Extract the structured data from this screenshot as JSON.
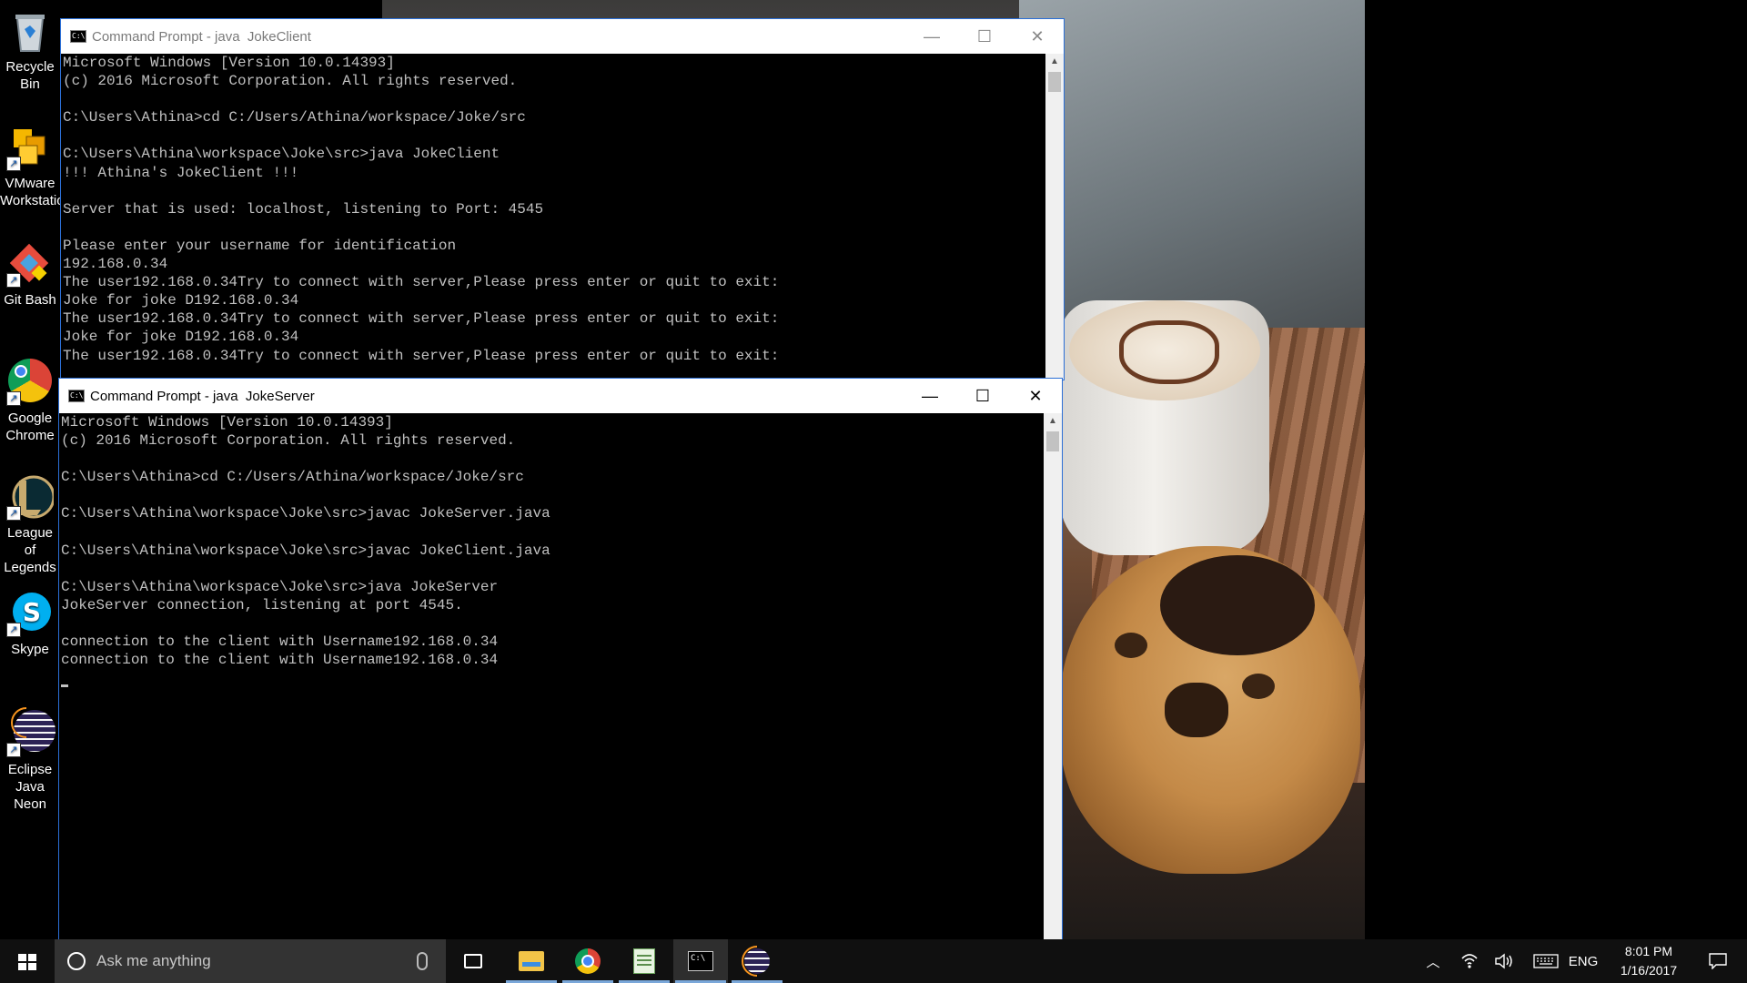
{
  "desktop": {
    "icons": [
      {
        "label": "Recycle Bin",
        "icon": "recycle-bin-icon"
      },
      {
        "label": "VMware Workstation",
        "icon": "vmware-icon"
      },
      {
        "label": "Git Bash",
        "icon": "git-bash-icon"
      },
      {
        "label": "Google Chrome",
        "icon": "chrome-icon"
      },
      {
        "label": "League of Legends",
        "icon": "league-icon"
      },
      {
        "label": "Skype",
        "icon": "skype-icon"
      },
      {
        "label": "Eclipse Java Neon",
        "icon": "eclipse-icon"
      }
    ]
  },
  "client_window": {
    "title": "Command Prompt - java  JokeClient",
    "minimize": "—",
    "maximize": "☐",
    "close": "✕",
    "lines": [
      "Microsoft Windows [Version 10.0.14393]",
      "(c) 2016 Microsoft Corporation. All rights reserved.",
      "",
      "C:\\Users\\Athina>cd C:/Users/Athina/workspace/Joke/src",
      "",
      "C:\\Users\\Athina\\workspace\\Joke\\src>java JokeClient",
      "!!! Athina's JokeClient !!!",
      "",
      "Server that is used: localhost, listening to Port: 4545",
      "",
      "Please enter your username for identification",
      "192.168.0.34",
      "The user192.168.0.34Try to connect with server,Please press enter or quit to exit:",
      "Joke for joke D192.168.0.34",
      "The user192.168.0.34Try to connect with server,Please press enter or quit to exit:",
      "Joke for joke D192.168.0.34",
      "The user192.168.0.34Try to connect with server,Please press enter or quit to exit:"
    ]
  },
  "server_window": {
    "title": "Command Prompt - java  JokeServer",
    "minimize": "—",
    "maximize": "☐",
    "close": "✕",
    "lines": [
      "Microsoft Windows [Version 10.0.14393]",
      "(c) 2016 Microsoft Corporation. All rights reserved.",
      "",
      "C:\\Users\\Athina>cd C:/Users/Athina/workspace/Joke/src",
      "",
      "C:\\Users\\Athina\\workspace\\Joke\\src>javac JokeServer.java",
      "",
      "C:\\Users\\Athina\\workspace\\Joke\\src>javac JokeClient.java",
      "",
      "C:\\Users\\Athina\\workspace\\Joke\\src>java JokeServer",
      "JokeServer connection, listening at port 4545.",
      "",
      "connection to the client with Username192.168.0.34",
      "connection to the client with Username192.168.0.34"
    ]
  },
  "taskbar": {
    "search_placeholder": "Ask me anything",
    "apps": [
      {
        "name": "task-view",
        "icon": "task-view-icon",
        "active": false
      },
      {
        "name": "file-explorer",
        "icon": "folder-icon",
        "active": false
      },
      {
        "name": "google-chrome",
        "icon": "chrome-icon",
        "active": false
      },
      {
        "name": "notepad-plus",
        "icon": "notepad-icon",
        "active": false
      },
      {
        "name": "command-prompt",
        "icon": "cmd-icon",
        "active": true
      },
      {
        "name": "eclipse",
        "icon": "eclipse-icon",
        "active": false
      }
    ],
    "tray": {
      "language": "ENG",
      "time": "8:01 PM",
      "date": "1/16/2017"
    }
  }
}
